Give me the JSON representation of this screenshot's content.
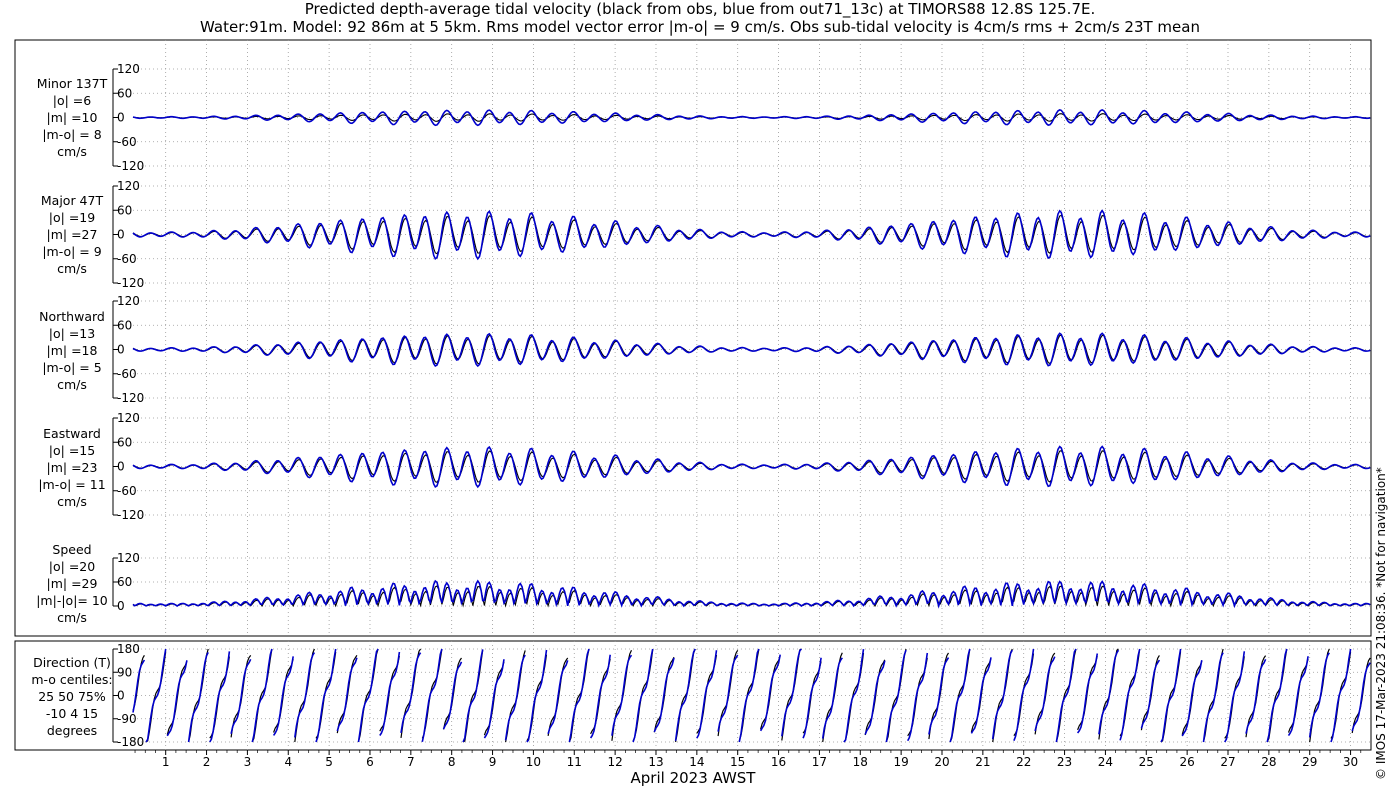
{
  "title_line1": "Predicted depth-average tidal velocity (black from obs, blue from out71_13c) at TIMORS88 12.8S 125.7E.",
  "title_line2": "Water:91m. Model: 92 86m at 5 5km. Rms model vector error |m-o| = 9 cm/s. Obs sub-tidal velocity is 4cm/s rms + 2cm/s 23T mean",
  "watermark": "© IMOS 17-Mar-2023 21:08:36. *Not for navigation*",
  "chart_data": {
    "type": "line",
    "xlabel": "April 2023 AWST",
    "x_ticks": [
      "1",
      "2",
      "3",
      "4",
      "5",
      "6",
      "7",
      "8",
      "9",
      "10",
      "11",
      "12",
      "13",
      "14",
      "15",
      "16",
      "17",
      "18",
      "19",
      "20",
      "21",
      "22",
      "23",
      "24",
      "25",
      "26",
      "27",
      "28",
      "29",
      "30"
    ],
    "xlim_days": [
      0.2,
      30.5
    ],
    "series_colors": {
      "obs": "#000000",
      "model": "#0000cc"
    },
    "panels": [
      {
        "id": "minor",
        "label_lines": [
          "Minor 137T",
          "|o| =6",
          "|m| =10",
          "|m-o| = 8",
          "cm/s"
        ],
        "ylim": [
          -120,
          120
        ],
        "yticks": [
          "120",
          "60",
          "0",
          "-60",
          "-120"
        ],
        "obs_amplitude": 8,
        "model_amplitude": 16
      },
      {
        "id": "major",
        "label_lines": [
          "Major 47T",
          "|o| =19",
          "|m| =27",
          "|m-o| = 9",
          "cm/s"
        ],
        "ylim": [
          -120,
          120
        ],
        "yticks": [
          "120",
          "60",
          "0",
          "-60",
          "-120"
        ],
        "obs_amplitude": 40,
        "model_amplitude": 50
      },
      {
        "id": "northward",
        "label_lines": [
          "Northward",
          "|o| =13",
          "|m| =18",
          "|m-o| = 5",
          "cm/s"
        ],
        "ylim": [
          -120,
          120
        ],
        "yticks": [
          "120",
          "60",
          "0",
          "-60",
          "-120"
        ],
        "obs_amplitude": 30,
        "model_amplitude": 34
      },
      {
        "id": "eastward",
        "label_lines": [
          "Eastward",
          "|o| =15",
          "|m| =23",
          "|m-o| = 11",
          "cm/s"
        ],
        "ylim": [
          -120,
          120
        ],
        "yticks": [
          "120",
          "60",
          "0",
          "-60",
          "-120"
        ],
        "obs_amplitude": 33,
        "model_amplitude": 42
      },
      {
        "id": "speed",
        "label_lines": [
          "Speed",
          "|o| =20",
          "|m| =29",
          "|m|-|o|= 10",
          "cm/s"
        ],
        "ylim": [
          0,
          120
        ],
        "yticks": [
          "120",
          "60",
          "0"
        ],
        "obs_amplitude": 42,
        "model_amplitude": 52
      },
      {
        "id": "direction",
        "label_lines": [
          "Direction (T)",
          "m-o centiles:",
          "25  50  75%",
          "-10   4  15",
          "degrees"
        ],
        "ylim": [
          -180,
          180
        ],
        "yticks": [
          "180",
          "90",
          "0",
          "-90",
          "-180"
        ]
      }
    ]
  }
}
